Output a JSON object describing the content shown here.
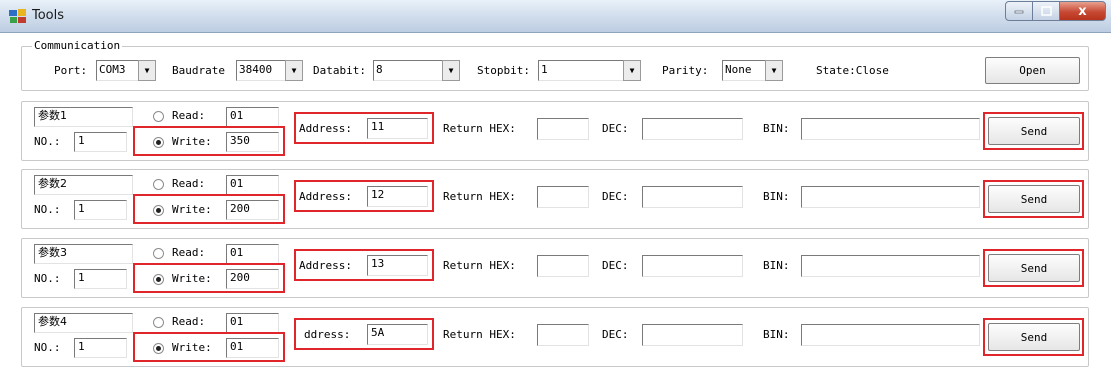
{
  "window": {
    "title": "Tools",
    "app_icon": "tools-app-icon",
    "close_symbol": "x"
  },
  "communication": {
    "legend": "Communication",
    "port": {
      "label": "Port:",
      "value": "COM3"
    },
    "baudrate": {
      "label": "Baudrate",
      "value": "38400"
    },
    "databit": {
      "label": "Databit:",
      "value": "8"
    },
    "stopbit": {
      "label": "Stopbit:",
      "value": "1"
    },
    "parity": {
      "label": "Parity:",
      "value": "None"
    },
    "state": "State:Close",
    "open_label": "Open"
  },
  "common": {
    "no_label": "NO.:",
    "read_label": "Read:",
    "write_label": "Write:",
    "address_label": "Address:",
    "address_label_cut": "ddress:",
    "return_hex_label": "Return HEX:",
    "dec_label": "DEC:",
    "bin_label": "BIN:",
    "send_label": "Send"
  },
  "params": [
    {
      "name": "参数1",
      "no": "1",
      "read": "01",
      "write": "350",
      "selected": "write",
      "address": "11",
      "return_hex": "",
      "dec": "",
      "bin": ""
    },
    {
      "name": "参数2",
      "no": "1",
      "read": "01",
      "write": "200",
      "selected": "write",
      "address": "12",
      "return_hex": "",
      "dec": "",
      "bin": ""
    },
    {
      "name": "参数3",
      "no": "1",
      "read": "01",
      "write": "200",
      "selected": "write",
      "address": "13",
      "return_hex": "",
      "dec": "",
      "bin": ""
    },
    {
      "name": "参数4",
      "no": "1",
      "read": "01",
      "write": "01",
      "selected": "write",
      "address": "5A",
      "return_hex": "",
      "dec": "",
      "bin": ""
    }
  ],
  "colors": {
    "highlight": "#e0262b",
    "titlebar": "#cfdcec",
    "close_button": "#c74a34"
  }
}
